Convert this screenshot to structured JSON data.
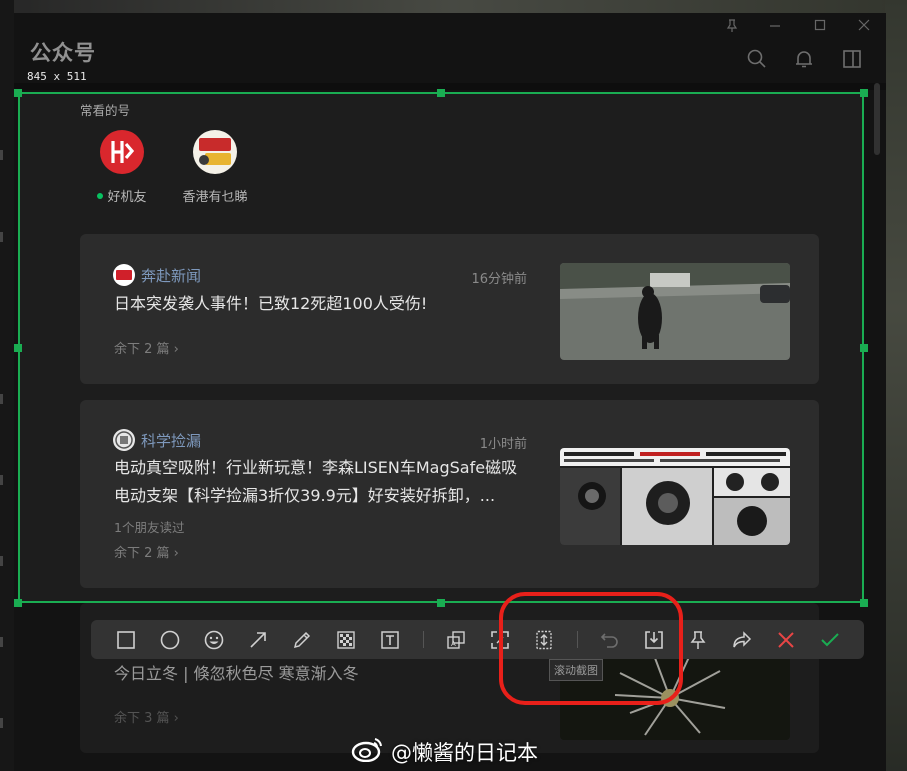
{
  "window": {
    "title": "公众号"
  },
  "capture": {
    "dimensions_label": "845 x 511"
  },
  "frequent": {
    "label": "常看的号",
    "accounts": [
      {
        "name": "好机友",
        "online": true
      },
      {
        "name": "香港有乜睇",
        "online": false
      }
    ]
  },
  "articles": [
    {
      "source": "奔赴新闻",
      "time": "16分钟前",
      "title": "日本突发袭人事件！已致12死超100人受伤!",
      "friends": "",
      "remaining": "余下 2 篇 ›"
    },
    {
      "source": "科学捡漏",
      "time": "1小时前",
      "title": "电动真空吸附！行业新玩意！李森LISEN车MagSafe磁吸电动支架【科学捡漏3折仅39.9元】好安装好拆卸，...",
      "friends": "1个朋友读过",
      "remaining": "余下 2 篇 ›"
    },
    {
      "source": "",
      "time": "",
      "title": "今日立冬 | 倏忽秋色尽 寒意渐入冬",
      "friends": "",
      "remaining": "余下 3 篇 ›"
    }
  ],
  "toolbar": {
    "tools": [
      "rectangle-icon",
      "ellipse-icon",
      "emoji-icon",
      "arrow-icon",
      "pencil-icon",
      "mosaic-icon",
      "text-icon",
      "ocr-icon",
      "screen-recognize-icon",
      "scroll-capture-icon",
      "undo-icon",
      "save-icon",
      "pin-icon",
      "share-icon",
      "cancel-icon",
      "confirm-icon"
    ],
    "tooltip": "滚动截图"
  },
  "watermark": {
    "text": "@懒酱的日记本"
  },
  "colors": {
    "selection": "#1aad52",
    "annotation": "#e8201a",
    "link": "#7e99bd",
    "accent": "#07c160"
  }
}
